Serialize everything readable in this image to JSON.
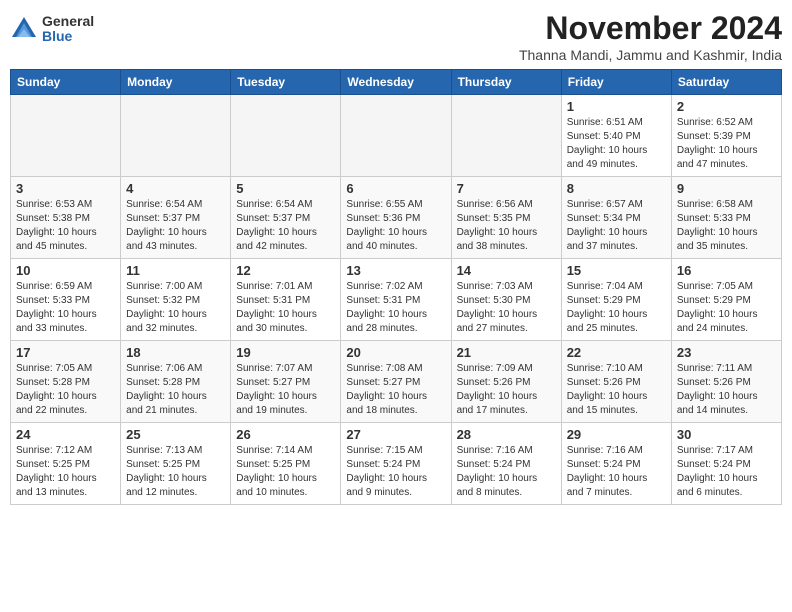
{
  "header": {
    "logo": {
      "general": "General",
      "blue": "Blue"
    },
    "month_title": "November 2024",
    "subtitle": "Thanna Mandi, Jammu and Kashmir, India"
  },
  "days_of_week": [
    "Sunday",
    "Monday",
    "Tuesday",
    "Wednesday",
    "Thursday",
    "Friday",
    "Saturday"
  ],
  "weeks": [
    [
      {
        "day": "",
        "info": ""
      },
      {
        "day": "",
        "info": ""
      },
      {
        "day": "",
        "info": ""
      },
      {
        "day": "",
        "info": ""
      },
      {
        "day": "",
        "info": ""
      },
      {
        "day": "1",
        "info": "Sunrise: 6:51 AM\nSunset: 5:40 PM\nDaylight: 10 hours\nand 49 minutes."
      },
      {
        "day": "2",
        "info": "Sunrise: 6:52 AM\nSunset: 5:39 PM\nDaylight: 10 hours\nand 47 minutes."
      }
    ],
    [
      {
        "day": "3",
        "info": "Sunrise: 6:53 AM\nSunset: 5:38 PM\nDaylight: 10 hours\nand 45 minutes."
      },
      {
        "day": "4",
        "info": "Sunrise: 6:54 AM\nSunset: 5:37 PM\nDaylight: 10 hours\nand 43 minutes."
      },
      {
        "day": "5",
        "info": "Sunrise: 6:54 AM\nSunset: 5:37 PM\nDaylight: 10 hours\nand 42 minutes."
      },
      {
        "day": "6",
        "info": "Sunrise: 6:55 AM\nSunset: 5:36 PM\nDaylight: 10 hours\nand 40 minutes."
      },
      {
        "day": "7",
        "info": "Sunrise: 6:56 AM\nSunset: 5:35 PM\nDaylight: 10 hours\nand 38 minutes."
      },
      {
        "day": "8",
        "info": "Sunrise: 6:57 AM\nSunset: 5:34 PM\nDaylight: 10 hours\nand 37 minutes."
      },
      {
        "day": "9",
        "info": "Sunrise: 6:58 AM\nSunset: 5:33 PM\nDaylight: 10 hours\nand 35 minutes."
      }
    ],
    [
      {
        "day": "10",
        "info": "Sunrise: 6:59 AM\nSunset: 5:33 PM\nDaylight: 10 hours\nand 33 minutes."
      },
      {
        "day": "11",
        "info": "Sunrise: 7:00 AM\nSunset: 5:32 PM\nDaylight: 10 hours\nand 32 minutes."
      },
      {
        "day": "12",
        "info": "Sunrise: 7:01 AM\nSunset: 5:31 PM\nDaylight: 10 hours\nand 30 minutes."
      },
      {
        "day": "13",
        "info": "Sunrise: 7:02 AM\nSunset: 5:31 PM\nDaylight: 10 hours\nand 28 minutes."
      },
      {
        "day": "14",
        "info": "Sunrise: 7:03 AM\nSunset: 5:30 PM\nDaylight: 10 hours\nand 27 minutes."
      },
      {
        "day": "15",
        "info": "Sunrise: 7:04 AM\nSunset: 5:29 PM\nDaylight: 10 hours\nand 25 minutes."
      },
      {
        "day": "16",
        "info": "Sunrise: 7:05 AM\nSunset: 5:29 PM\nDaylight: 10 hours\nand 24 minutes."
      }
    ],
    [
      {
        "day": "17",
        "info": "Sunrise: 7:05 AM\nSunset: 5:28 PM\nDaylight: 10 hours\nand 22 minutes."
      },
      {
        "day": "18",
        "info": "Sunrise: 7:06 AM\nSunset: 5:28 PM\nDaylight: 10 hours\nand 21 minutes."
      },
      {
        "day": "19",
        "info": "Sunrise: 7:07 AM\nSunset: 5:27 PM\nDaylight: 10 hours\nand 19 minutes."
      },
      {
        "day": "20",
        "info": "Sunrise: 7:08 AM\nSunset: 5:27 PM\nDaylight: 10 hours\nand 18 minutes."
      },
      {
        "day": "21",
        "info": "Sunrise: 7:09 AM\nSunset: 5:26 PM\nDaylight: 10 hours\nand 17 minutes."
      },
      {
        "day": "22",
        "info": "Sunrise: 7:10 AM\nSunset: 5:26 PM\nDaylight: 10 hours\nand 15 minutes."
      },
      {
        "day": "23",
        "info": "Sunrise: 7:11 AM\nSunset: 5:26 PM\nDaylight: 10 hours\nand 14 minutes."
      }
    ],
    [
      {
        "day": "24",
        "info": "Sunrise: 7:12 AM\nSunset: 5:25 PM\nDaylight: 10 hours\nand 13 minutes."
      },
      {
        "day": "25",
        "info": "Sunrise: 7:13 AM\nSunset: 5:25 PM\nDaylight: 10 hours\nand 12 minutes."
      },
      {
        "day": "26",
        "info": "Sunrise: 7:14 AM\nSunset: 5:25 PM\nDaylight: 10 hours\nand 10 minutes."
      },
      {
        "day": "27",
        "info": "Sunrise: 7:15 AM\nSunset: 5:24 PM\nDaylight: 10 hours\nand 9 minutes."
      },
      {
        "day": "28",
        "info": "Sunrise: 7:16 AM\nSunset: 5:24 PM\nDaylight: 10 hours\nand 8 minutes."
      },
      {
        "day": "29",
        "info": "Sunrise: 7:16 AM\nSunset: 5:24 PM\nDaylight: 10 hours\nand 7 minutes."
      },
      {
        "day": "30",
        "info": "Sunrise: 7:17 AM\nSunset: 5:24 PM\nDaylight: 10 hours\nand 6 minutes."
      }
    ]
  ]
}
